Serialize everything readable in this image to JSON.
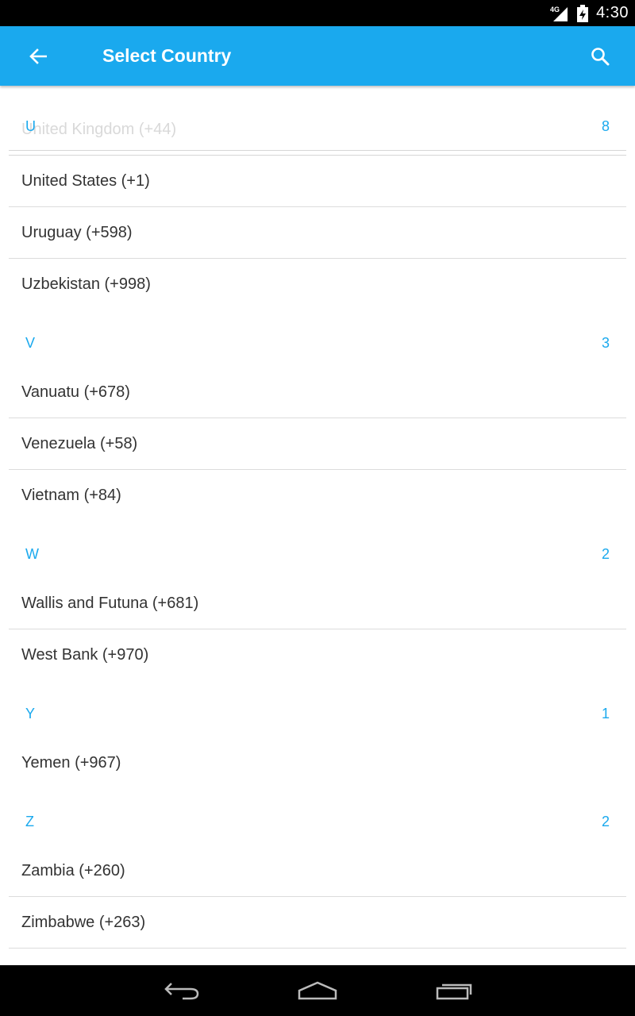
{
  "status_bar": {
    "network": "4G",
    "time": "4:30"
  },
  "app_bar": {
    "title": "Select Country"
  },
  "list": {
    "partial_row": "United Kingdom (+44)",
    "sections": [
      {
        "letter": "U",
        "count": "8",
        "items": [
          "United States (+1)",
          "Uruguay (+598)",
          "Uzbekistan (+998)"
        ]
      },
      {
        "letter": "V",
        "count": "3",
        "items": [
          "Vanuatu (+678)",
          "Venezuela (+58)",
          "Vietnam (+84)"
        ]
      },
      {
        "letter": "W",
        "count": "2",
        "items": [
          "Wallis and Futuna (+681)",
          "West Bank (+970)"
        ]
      },
      {
        "letter": "Y",
        "count": "1",
        "items": [
          "Yemen (+967)"
        ]
      },
      {
        "letter": "Z",
        "count": "2",
        "items": [
          "Zambia (+260)",
          "Zimbabwe (+263)"
        ]
      }
    ]
  },
  "colors": {
    "accent": "#1aa9ee",
    "text": "#333333",
    "divider": "#dcdcdc"
  }
}
